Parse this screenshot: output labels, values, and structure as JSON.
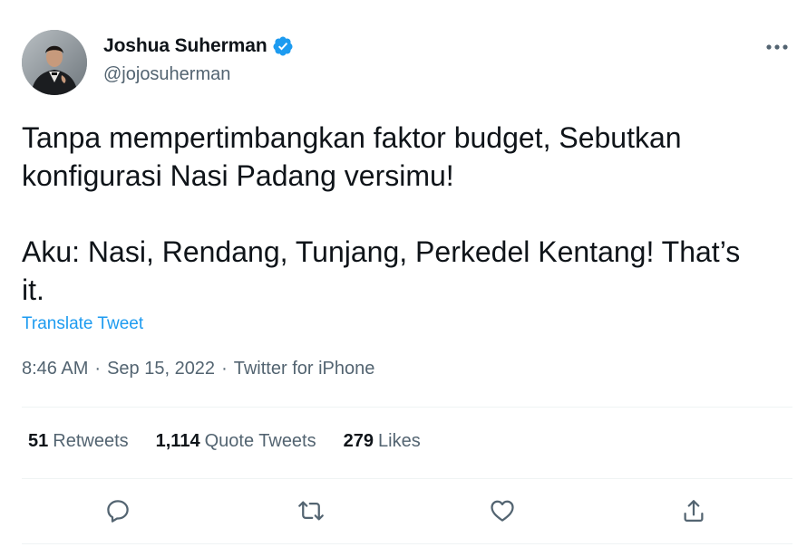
{
  "author": {
    "display_name": "Joshua Suherman",
    "handle": "@jojosuherman",
    "verified": true
  },
  "tweet": {
    "text": "Tanpa mempertimbangkan faktor budget, Sebutkan\nkonfigurasi Nasi Padang versimu!\n\nAku: Nasi, Rendang, Tunjang, Perkedel Kentang! That’s\nit.",
    "translate_label": "Translate Tweet",
    "time": "8:46 AM",
    "date": "Sep 15, 2022",
    "source": "Twitter for iPhone",
    "separator": "·"
  },
  "stats": {
    "retweets_count": "51",
    "retweets_label": "Retweets",
    "quotes_count": "1,114",
    "quotes_label": "Quote Tweets",
    "likes_count": "279",
    "likes_label": "Likes"
  },
  "icons": {
    "more": "more-horizontal-icon",
    "verified": "verified-badge-icon",
    "reply": "reply-icon",
    "retweet": "retweet-icon",
    "like": "heart-icon",
    "share": "share-icon"
  },
  "colors": {
    "text_primary": "#0f1419",
    "text_secondary": "#536471",
    "link": "#1d9bf0",
    "verified": "#1d9bf0",
    "divider": "#eff3f4"
  }
}
